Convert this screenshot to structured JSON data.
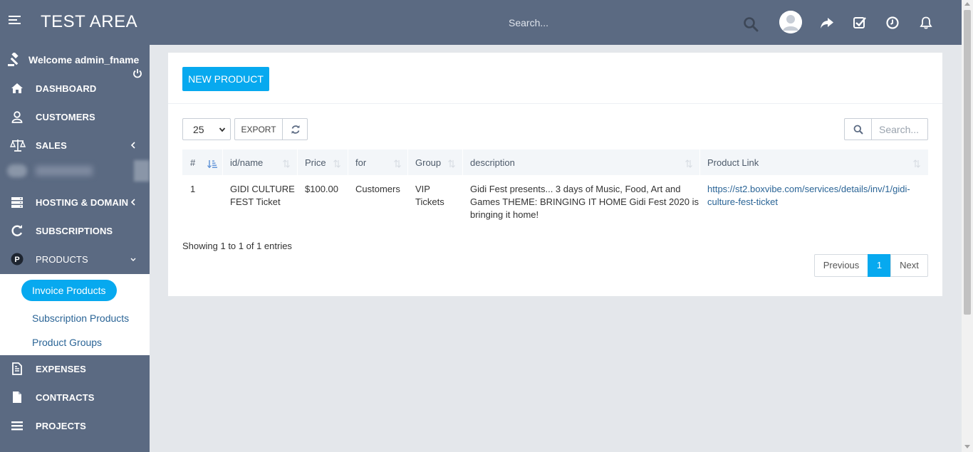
{
  "app": {
    "title": "TEST AREA"
  },
  "header": {
    "search_placeholder": "Search...",
    "icons": [
      "menu-icon",
      "search-icon",
      "avatar",
      "share-icon",
      "checkbox-icon",
      "clock-icon",
      "bell-icon"
    ]
  },
  "sidebar": {
    "welcome": "Welcome admin_fname",
    "items": [
      {
        "label": "DASHBOARD",
        "icon": "home-icon"
      },
      {
        "label": "CUSTOMERS",
        "icon": "user-icon"
      },
      {
        "label": "SALES",
        "icon": "scale-icon"
      },
      {
        "label": "HOSTING & DOMAIN",
        "icon": "server-icon"
      },
      {
        "label": "SUBSCRIPTIONS",
        "icon": "refresh-icon"
      },
      {
        "label": "PRODUCTS",
        "icon": "p-circle-icon"
      },
      {
        "label": "EXPENSES",
        "icon": "document-icon"
      },
      {
        "label": "CONTRACTS",
        "icon": "file-icon"
      },
      {
        "label": "PROJECTS",
        "icon": "list-icon"
      }
    ],
    "products_submenu": {
      "active": "Invoice Products",
      "links": [
        "Subscription Products",
        "Product Groups"
      ]
    }
  },
  "toolbar": {
    "new_product_label": "NEW PRODUCT",
    "page_length": "25",
    "export_label": "EXPORT",
    "search_placeholder": "Search..."
  },
  "table": {
    "columns": [
      "#",
      "id/name",
      "Price",
      "for",
      "Group",
      "description",
      "Product Link"
    ],
    "rows": [
      {
        "num": "1",
        "name_line1": "GIDI CULTURE",
        "name_line2": "FEST Ticket",
        "price": "$100.00",
        "for": "Customers",
        "group_line1": "VIP",
        "group_line2": "Tickets",
        "desc_line1": "Gidi Fest presents... 3 days of Music, Food, Art and",
        "desc_line2": "Games THEME: BRINGING IT HOME Gidi Fest 2020 is",
        "desc_line3": "bringing it home!",
        "link_line1": "https://st2.boxvibe.com/services/details/inv/1/gidi-",
        "link_line2": "culture-fest-ticket"
      }
    ],
    "info": "Showing 1 to 1 of 1 entries"
  },
  "pagination": {
    "previous": "Previous",
    "current": "1",
    "next": "Next"
  },
  "colors": {
    "header_bg": "#5b6a82",
    "accent": "#07a9ef",
    "link": "#2a6496",
    "page_bg": "#e4e7eb"
  }
}
